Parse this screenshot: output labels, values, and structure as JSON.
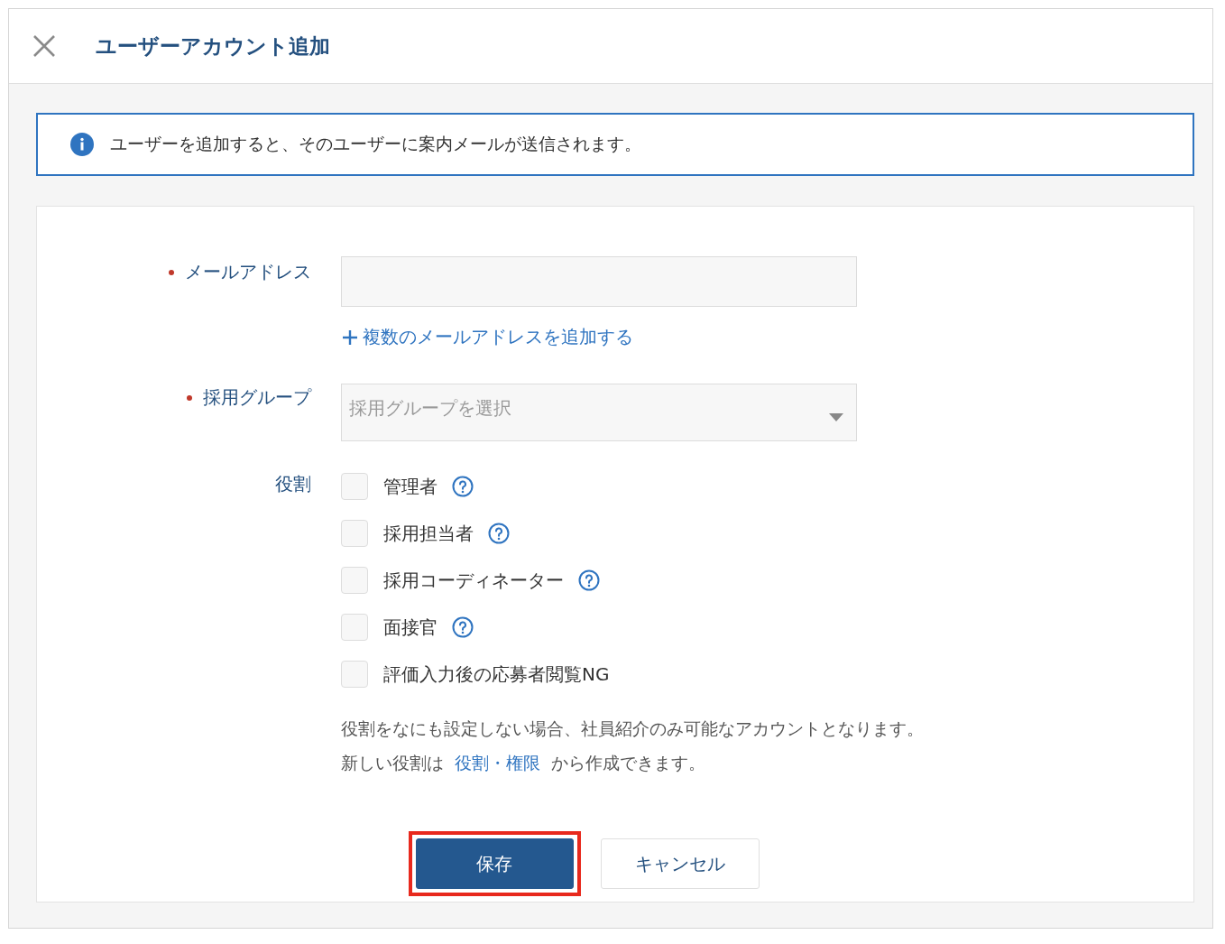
{
  "dialog": {
    "title": "ユーザーアカウント追加"
  },
  "info": {
    "message": "ユーザーを追加すると、そのユーザーに案内メールが送信されます。"
  },
  "form": {
    "fields": [
      {
        "kind": "input",
        "label": "メールアドレス",
        "required": true,
        "link": "複数のメールアドレスを追加する"
      },
      {
        "kind": "select",
        "label": "採用グループ",
        "required": true,
        "placeholder": "採用グループを選択"
      },
      {
        "kind": "checkboxes",
        "label": "役割",
        "required": false,
        "options": [
          {
            "label": "管理者",
            "checked": false,
            "help": true
          },
          {
            "label": "採用担当者",
            "checked": false,
            "help": true
          },
          {
            "label": "採用コーディネーター",
            "checked": false,
            "help": true
          },
          {
            "label": "面接官",
            "checked": false,
            "help": true
          },
          {
            "label": "評価入力後の応募者閲覧NG",
            "checked": false,
            "help": false
          }
        ]
      }
    ],
    "note": "役割をなにも設定しない場合、社員紹介のみ可能なアカウントとなります。",
    "note2": {
      "prefix": "新しい役割は",
      "link": "役割・権限",
      "suffix": "から作成できます。"
    }
  },
  "buttons": [
    {
      "kind": "primary",
      "label": "保存",
      "highlighted": true
    },
    {
      "kind": "secondary",
      "label": "キャンセル",
      "highlighted": false
    }
  ]
}
